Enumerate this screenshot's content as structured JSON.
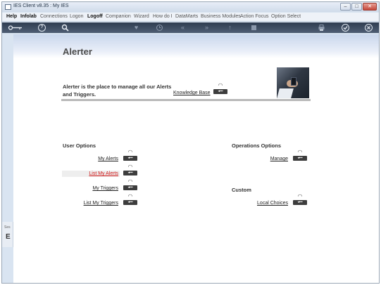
{
  "window": {
    "title": "IES Client v8.35 : My IES"
  },
  "window_controls": {
    "minimize": "–",
    "restore": "□",
    "close": "✕"
  },
  "menu": [
    {
      "label": "Help",
      "strong": true
    },
    {
      "label": "Infolab",
      "strong": true
    },
    {
      "label": "Connections",
      "strong": false
    },
    {
      "label": "Logon",
      "strong": false
    },
    {
      "label": "Logoff",
      "strong": true
    },
    {
      "label": "Companion",
      "strong": false
    },
    {
      "label": "Wizard",
      "strong": false
    },
    {
      "label": "How do I",
      "strong": false
    },
    {
      "label": "DataMarts",
      "strong": false
    },
    {
      "label": "Business Modules",
      "strong": false
    },
    {
      "label": "Action Focus",
      "strong": false
    },
    {
      "label": "Option Select",
      "strong": false
    }
  ],
  "toolbar": {
    "key_icon": "key-icon",
    "help_icon": "help-icon",
    "search_icon": "search-icon",
    "heart_icon": "heart-icon",
    "clock_icon": "clock-icon",
    "back_icon": "double-chevron-left-icon",
    "forward_icon": "double-chevron-right-icon",
    "up_icon": "up-arrow-icon",
    "stop_icon": "stop-icon",
    "print_icon": "print-icon",
    "check_icon": "check-icon",
    "close_icon": "close-icon",
    "help_glyph": "?"
  },
  "page": {
    "title": "Alerter",
    "intro": "Alerter is the place to manage all our Alerts and Triggers.",
    "knowledge_base": "Knowledge Base"
  },
  "user_options": {
    "heading": "User Options",
    "items": [
      {
        "label": "My Alerts",
        "active": false
      },
      {
        "label": "List My Alerts",
        "active": true
      },
      {
        "label": "My Triggers",
        "active": false
      },
      {
        "label": "List My Triggers",
        "active": false
      }
    ]
  },
  "operations_options": {
    "heading": "Operations Options",
    "items": [
      {
        "label": "Manage"
      }
    ]
  },
  "custom": {
    "heading": "Custom",
    "items": [
      {
        "label": "Local Choices"
      }
    ]
  },
  "side_tab": {
    "label1": "Ses",
    "label2": "E"
  },
  "colors": {
    "active_link": "#d01818",
    "toolbar_bg": "#3a485c",
    "header_band": "#c9d6ec"
  }
}
